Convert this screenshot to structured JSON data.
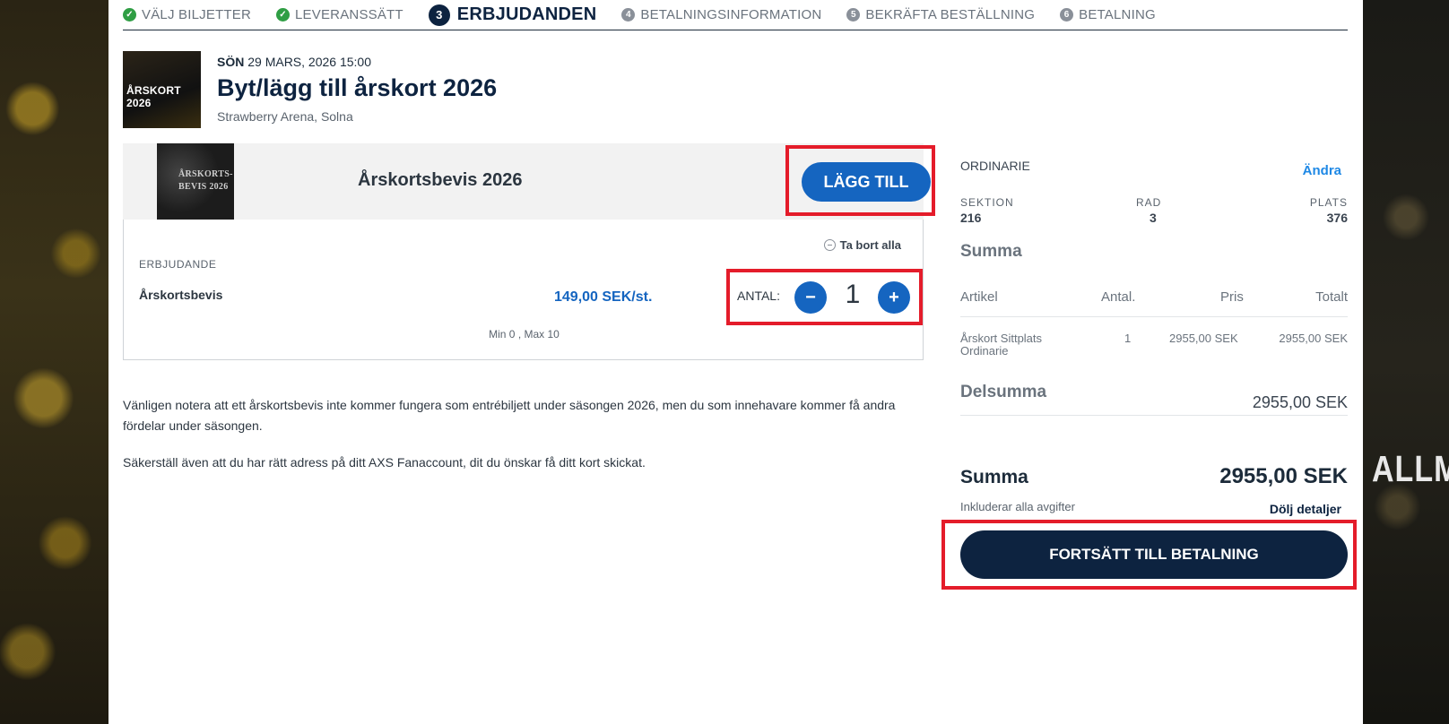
{
  "steps": [
    {
      "label": "VÄLJ BILJETTER",
      "state": "done"
    },
    {
      "label": "LEVERANSSÄTT",
      "state": "done"
    },
    {
      "number": "3",
      "label": "ERBJUDANDEN",
      "state": "active"
    },
    {
      "number": "4",
      "label": "BETALNINGSINFORMATION",
      "state": "todo"
    },
    {
      "number": "5",
      "label": "BEKRÄFTA BESTÄLLNING",
      "state": "todo"
    },
    {
      "number": "6",
      "label": "BETALNING",
      "state": "todo"
    }
  ],
  "event": {
    "thumb_text": "ÅRSKORT 2026",
    "day": "SÖN",
    "date": "29 MARS, 2026 15:00",
    "title": "Byt/lägg till årskort 2026",
    "venue": "Strawberry Arena, Solna"
  },
  "offer": {
    "image_line1": "ÅRSKORTS-",
    "image_line2": "BEVIS 2026",
    "name": "Årskortsbevis 2026",
    "add_label": "LÄGG TILL",
    "remove_all": "Ta bort alla",
    "section_label": "ERBJUDANDE",
    "item": "Årskortsbevis",
    "price": "149,00 SEK/st.",
    "qty_label": "ANTAL:",
    "minus": "−",
    "plus": "+",
    "qty": "1",
    "minmax": "Min 0 , Max 10"
  },
  "notes": {
    "note1": "Vänligen notera att ett årskortsbevis inte kommer fungera som entrébiljett under säsongen 2026, men du som innehavare kommer få andra fördelar under säsongen.",
    "note2": "Säkerställ även att du har rätt adress på ditt AXS Fanaccount, dit du önskar få ditt kort skickat."
  },
  "summary": {
    "ticket_type": "ORDINARIE",
    "change": "Ändra",
    "section_label": "SEKTION",
    "section": "216",
    "row_label": "RAD",
    "row": "3",
    "seat_label": "PLATS",
    "seat": "376",
    "heading": "Summa",
    "col_article": "Artikel",
    "col_qty": "Antal.",
    "col_price": "Pris",
    "col_total": "Totalt",
    "line_article_1": "Årskort Sittplats",
    "line_article_2": "Ordinarie",
    "line_qty": "1",
    "line_price": "2955,00 SEK",
    "line_total": "2955,00 SEK",
    "subtotal_label": "Delsumma",
    "subtotal": "2955,00 SEK",
    "total_label": "Summa",
    "total": "2955,00 SEK",
    "incl": "Inkluderar alla avgifter",
    "hide": "Dölj detaljer",
    "pay": "FORTSÄTT TILL BETALNING"
  },
  "background_text": "ALLM",
  "colors": {
    "accent_blue": "#1565c0",
    "navy": "#0d2340",
    "highlight_red": "#e41c2a",
    "done_green": "#2f9e44"
  }
}
